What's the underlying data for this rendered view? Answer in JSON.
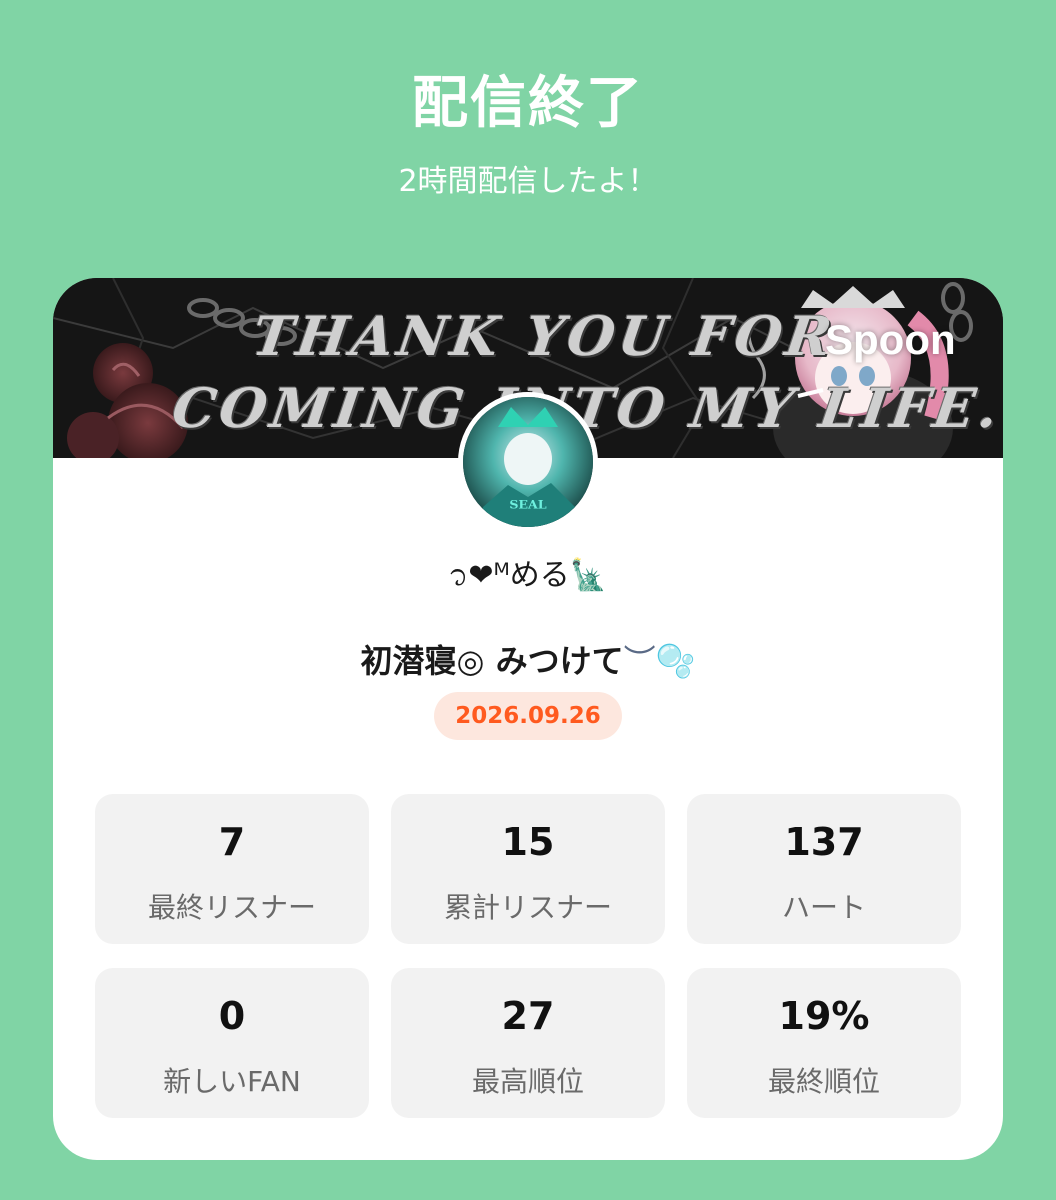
{
  "header": {
    "title": "配信終了",
    "subtitle": "2時間配信したよ！"
  },
  "banner": {
    "line1": "THANK YOU FOR",
    "line2": "COMING INTO MY LIFE.",
    "brand": "Spoon"
  },
  "profile": {
    "username": "᭡❤︎ᴹめる🗽"
  },
  "broadcast": {
    "title_text": "初潜寝◎ みつけて",
    "title_deco": "︶🫧",
    "date": "2026.09.26"
  },
  "stats": [
    {
      "value": "7",
      "label": "最終リスナー"
    },
    {
      "value": "15",
      "label": "累計リスナー"
    },
    {
      "value": "137",
      "label": "ハート"
    },
    {
      "value": "0",
      "label": "新しいFAN"
    },
    {
      "value": "27",
      "label": "最高順位"
    },
    {
      "value": "19%",
      "label": "最終順位"
    }
  ],
  "colors": {
    "background": "#80d4a5",
    "card": "#ffffff",
    "date_text": "#ff5a1f",
    "date_badge": "#fde7de",
    "stat_tile": "#f2f2f2"
  }
}
